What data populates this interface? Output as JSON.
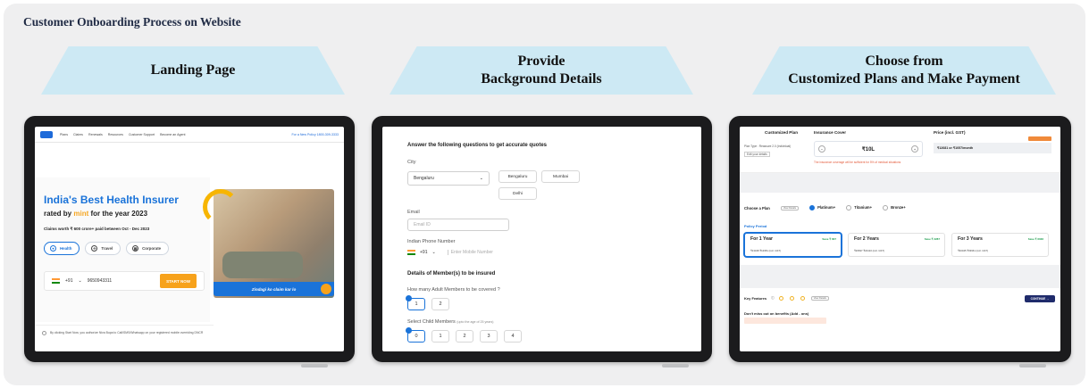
{
  "title": "Customer Onboarding  Process on Website",
  "steps": [
    {
      "label": "Landing Page"
    },
    {
      "label_line1": "Provide",
      "label_line2": "Background Details"
    },
    {
      "label_line1": "Choose from",
      "label_line2": "Customized Plans and Make Payment"
    }
  ],
  "colors": {
    "panel": "#efeff0",
    "banner": "#cde9f4",
    "brand_blue": "#1a73d9",
    "accent_orange": "#f7a21b",
    "tablet_frame": "#1b1b1d"
  },
  "landing": {
    "nav_items": [
      "Plans",
      "Claims",
      "Renewals",
      "Resources",
      "Customer Support",
      "Become an Agent"
    ],
    "nav_help": "For a New Policy 1800-309-3333",
    "headline": "India's Best Health Insurer",
    "subline_prefix": "rated by",
    "subline_brand": "mint",
    "subline_suffix": "for the year 2023",
    "claims": "Claims worth ₹ 600 crore+ paid between Oct - Dec 2023",
    "pills": [
      "Health",
      "Travel",
      "Corporate"
    ],
    "country_code": "+91",
    "phone": "9650943311",
    "start_label": "START NOW",
    "image_caption": "Zindagi ko claim kar lo",
    "disclaimer": "By clicking Start Now, you authorize Niva Bupa to Call/SMS/Whatsapp on your registered mobile overriding DNCR"
  },
  "details": {
    "heading": "Answer the following questions to get accurate quotes",
    "city_label": "City",
    "city_value": "Bengaluru",
    "city_chips": [
      "Bengaluru",
      "Mumbai",
      "Delhi"
    ],
    "email_label": "Email",
    "email_placeholder": "Email ID",
    "phone_label": "Indian Phone Number",
    "country_code": "+91",
    "phone_placeholder": "Enter Mobile Number",
    "members_heading": "Details of Member(s) to be insured",
    "adults_question": "How many Adult Members to be covered ?",
    "adult_options": [
      "1",
      "2"
    ],
    "child_label": "Select Child Members",
    "child_hint": "(upto the age of 25 years)",
    "child_options": [
      "0",
      "1",
      "2",
      "3",
      "4"
    ]
  },
  "plans": {
    "customized_title": "Customized Plan",
    "plan_type": "Plan Type : Reassure 2.0 (Individual)",
    "edit_details": "Edit your details",
    "cover_title": "Insurance Cover",
    "cover_value": "₹10L",
    "cover_note": "The insurance coverage will be sufficient for 5% of medical situations",
    "price_title": "Price (incl. GST)",
    "price_text": "₹12681 or ₹1057/month",
    "choose_plan": "Choose a Plan",
    "view_details": "View Details",
    "plan_options": [
      "Platinum+",
      "Titanium+",
      "Bronze+"
    ],
    "period_title": "Policy Period",
    "periods": [
      {
        "label": "For 1 Year",
        "save": "Save ₹ 667",
        "price": "₹13348 ₹12681 (incl. GST)"
      },
      {
        "label": "For 2 Years",
        "save": "Save ₹ 2287",
        "price": "₹26697 ₹24410 (incl. GST)"
      },
      {
        "label": "For 3 Years",
        "save": "Save ₹ 6036",
        "price": "₹40045 ₹33961 (incl. GST)"
      }
    ],
    "key_features": "Key Features",
    "continue_label": "CONTINUE →",
    "miss_out": "Don't miss out on benefits (Add - ons)"
  }
}
